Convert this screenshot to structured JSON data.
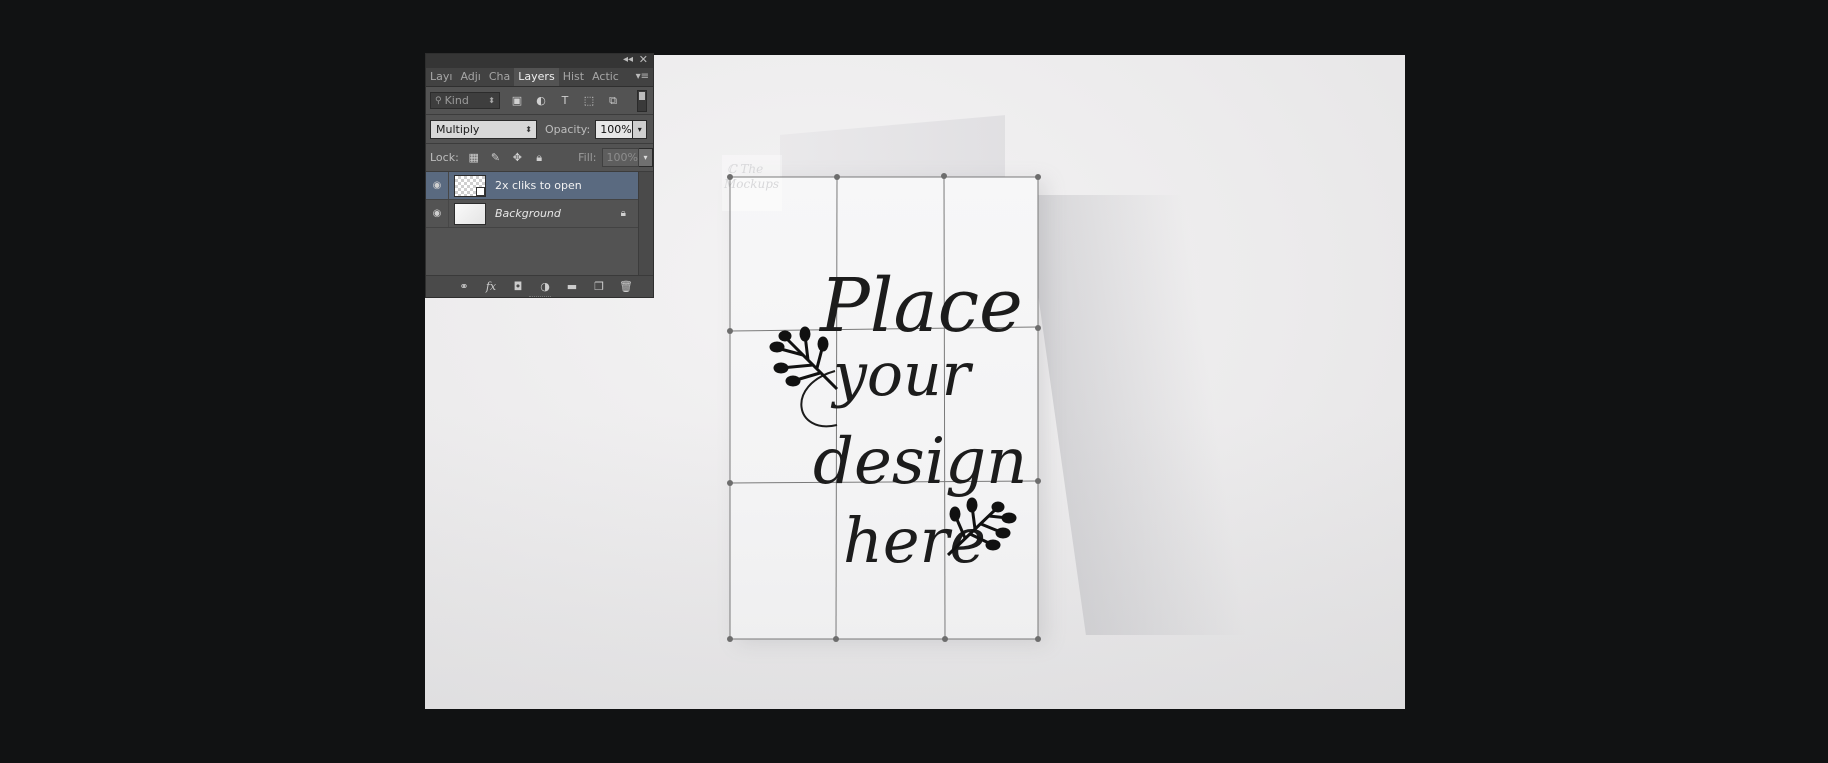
{
  "colors": {
    "app_background": "#111213",
    "panel_bg": "#535353",
    "selected_layer": "#5a6a80",
    "transform_grid": "#7a7a7a"
  },
  "layers_panel": {
    "tabs": [
      {
        "label": "Layı",
        "icon": "layer-comps-tab"
      },
      {
        "label": "Adjı",
        "icon": "adjustments-tab"
      },
      {
        "label": "Cha",
        "icon": "channels-tab"
      },
      {
        "label": "Layers",
        "active": true
      },
      {
        "label": "Hist",
        "icon": "history-tab"
      },
      {
        "label": "Actic",
        "icon": "actions-tab"
      }
    ],
    "filter": {
      "kind_label": "Kind",
      "icons": [
        "image-filter-icon",
        "adjustment-filter-icon",
        "type-filter-icon",
        "shape-filter-icon",
        "smart-object-filter-icon"
      ]
    },
    "blend_mode": "Multiply",
    "opacity_label": "Opacity:",
    "opacity_value": "100%",
    "lock_label": "Lock:",
    "lock_icons": [
      "lock-transparent-icon",
      "lock-image-icon",
      "lock-position-icon",
      "lock-all-icon"
    ],
    "fill_label": "Fill:",
    "fill_value": "100%",
    "layers": [
      {
        "name": "2x cliks to open",
        "selected": true,
        "type": "smart-object",
        "visible": true
      },
      {
        "name": "Background",
        "selected": false,
        "type": "background",
        "locked": true,
        "visible": true
      }
    ],
    "bottom_icons": [
      "link-layers-icon",
      "fx-icon",
      "layer-mask-icon",
      "adjustment-layer-icon",
      "group-folder-icon",
      "new-layer-icon",
      "trash-icon"
    ],
    "fx_label": "fx"
  },
  "canvas": {
    "design_text": [
      "Place",
      "your",
      "design",
      "here"
    ],
    "watermark_text": [
      "ℂ The",
      "Mockups"
    ]
  }
}
